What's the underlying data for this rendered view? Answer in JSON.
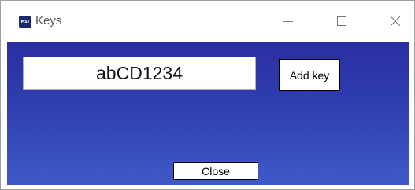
{
  "window": {
    "title": "Keys",
    "app_icon_text": "MST",
    "controls": [
      "minimize-icon",
      "maximize-icon",
      "close-icon"
    ]
  },
  "form": {
    "key_value": "abCD1234",
    "add_key_label": "Add key",
    "close_label": "Close"
  },
  "colors": {
    "client_gradient_top": "#2a2ea0",
    "client_gradient_bottom": "#3f5ac8",
    "button_border": "#000000"
  }
}
